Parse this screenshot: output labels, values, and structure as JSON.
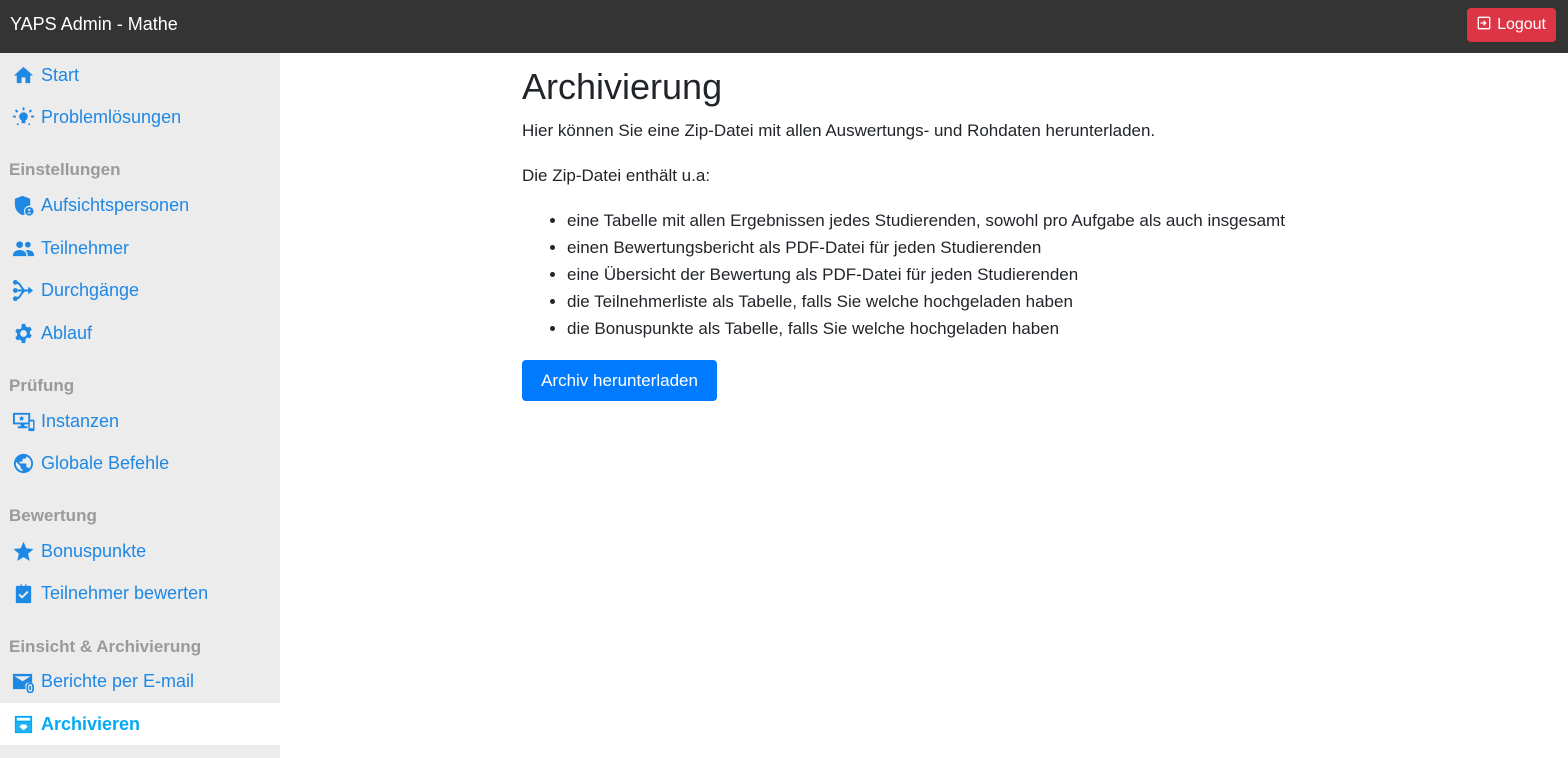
{
  "header": {
    "title": "YAPS Admin - Mathe",
    "logout_label": "Logout"
  },
  "sidebar": {
    "start": "Start",
    "problemloesungen": "Problemlösungen",
    "sections": {
      "einstellungen": "Einstellungen",
      "pruefung": "Prüfung",
      "bewertung": "Bewertung",
      "einsicht": "Einsicht & Archivierung"
    },
    "items": {
      "aufsichtspersonen": "Aufsichtspersonen",
      "teilnehmer": "Teilnehmer",
      "durchgaenge": "Durchgänge",
      "ablauf": "Ablauf",
      "instanzen": "Instanzen",
      "globale_befehle": "Globale Befehle",
      "bonuspunkte": "Bonuspunkte",
      "teilnehmer_bewerten": "Teilnehmer bewerten",
      "berichte": "Berichte per E-mail",
      "archivieren": "Archivieren"
    }
  },
  "main": {
    "title": "Archivierung",
    "intro": "Hier können Sie eine Zip-Datei mit allen Auswertungs- und Rohdaten herunterladen.",
    "contains_label": "Die Zip-Datei enthält u.a:",
    "list": [
      "eine Tabelle mit allen Ergebnissen jedes Studierenden, sowohl pro Aufgabe als auch insgesamt",
      "einen Bewertungsbericht als PDF-Datei für jeden Studierenden",
      "eine Übersicht der Bewertung als PDF-Datei für jeden Studierenden",
      "die Teilnehmerliste als Tabelle, falls Sie welche hochgeladen haben",
      "die Bonuspunkte als Tabelle, falls Sie welche hochgeladen haben"
    ],
    "download_label": "Archiv herunterladen"
  },
  "colors": {
    "topbar": "#343434",
    "logout": "#dc3545",
    "link": "#1e88e5",
    "active": "#03a9f4",
    "primary_button": "#007bff",
    "sidebar_bg": "#ececec"
  }
}
